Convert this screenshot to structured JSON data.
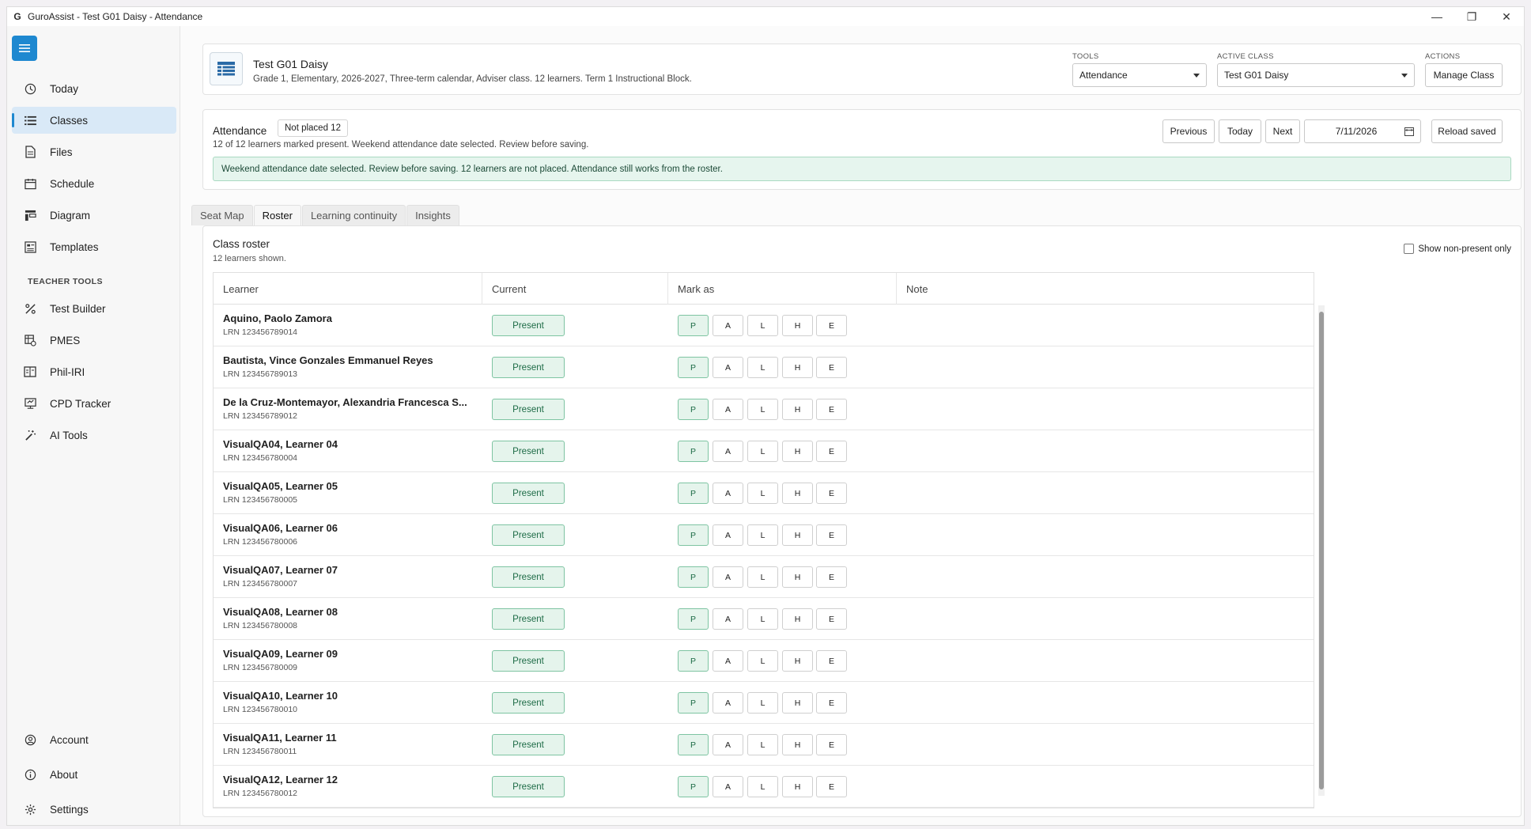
{
  "window": {
    "title": "GuroAssist - Test G01 Daisy - Attendance",
    "controls": {
      "minimize": "—",
      "maximize": "❐",
      "close": "✕"
    }
  },
  "sidebar": {
    "menu_icon": "hamburger-icon",
    "items": [
      {
        "label": "Today",
        "icon": "clock-icon"
      },
      {
        "label": "Classes",
        "icon": "list-icon",
        "active": true
      },
      {
        "label": "Files",
        "icon": "file-icon"
      },
      {
        "label": "Schedule",
        "icon": "calendar-icon"
      },
      {
        "label": "Diagram",
        "icon": "diagram-icon"
      },
      {
        "label": "Templates",
        "icon": "templates-icon"
      }
    ],
    "section_title": "TEACHER TOOLS",
    "tools": [
      {
        "label": "Test Builder",
        "icon": "percent-icon"
      },
      {
        "label": "PMES",
        "icon": "pmes-icon"
      },
      {
        "label": "Phil-IRI",
        "icon": "book-icon"
      },
      {
        "label": "CPD Tracker",
        "icon": "tracker-icon"
      },
      {
        "label": "AI Tools",
        "icon": "magic-wand-icon"
      }
    ],
    "bottom": [
      {
        "label": "Account",
        "icon": "account-icon"
      },
      {
        "label": "About",
        "icon": "info-icon"
      },
      {
        "label": "Settings",
        "icon": "gear-icon"
      }
    ]
  },
  "header": {
    "class_name": "Test G01 Daisy",
    "class_details": "Grade 1, Elementary, 2026-2027, Three-term calendar, Adviser class. 12 learners. Term 1 Instructional Block.",
    "tools_label": "TOOLS",
    "tools_value": "Attendance",
    "active_class_label": "ACTIVE CLASS",
    "active_class_value": "Test G01 Daisy",
    "actions_label": "ACTIONS",
    "manage_class": "Manage Class"
  },
  "attendance": {
    "title": "Attendance",
    "not_placed_badge": "Not placed 12",
    "summary": "12 of 12 learners marked present. Weekend attendance date selected. Review before saving.",
    "notice": "Weekend attendance date selected. Review before saving. 12 learners are not placed. Attendance still works from the roster.",
    "buttons": {
      "previous": "Previous",
      "today": "Today",
      "next": "Next",
      "reload": "Reload saved"
    },
    "date": "7/11/2026"
  },
  "tabs": [
    {
      "label": "Seat Map"
    },
    {
      "label": "Roster",
      "active": true
    },
    {
      "label": "Learning continuity"
    },
    {
      "label": "Insights"
    }
  ],
  "roster": {
    "title": "Class roster",
    "subtitle": "12 learners shown.",
    "filter_label": "Show non-present only",
    "columns": [
      "Learner",
      "Current",
      "Mark as",
      "Note"
    ],
    "mark_options": [
      "P",
      "A",
      "L",
      "H",
      "E"
    ],
    "rows": [
      {
        "name": "Aquino, Paolo Zamora",
        "lrn": "LRN 123456789014",
        "status": "Present"
      },
      {
        "name": "Bautista, Vince Gonzales Emmanuel Reyes",
        "lrn": "LRN 123456789013",
        "status": "Present"
      },
      {
        "name": "De la Cruz-Montemayor, Alexandria Francesca S...",
        "lrn": "LRN 123456789012",
        "status": "Present"
      },
      {
        "name": "VisualQA04, Learner 04",
        "lrn": "LRN 123456780004",
        "status": "Present"
      },
      {
        "name": "VisualQA05, Learner 05",
        "lrn": "LRN 123456780005",
        "status": "Present"
      },
      {
        "name": "VisualQA06, Learner 06",
        "lrn": "LRN 123456780006",
        "status": "Present"
      },
      {
        "name": "VisualQA07, Learner 07",
        "lrn": "LRN 123456780007",
        "status": "Present"
      },
      {
        "name": "VisualQA08, Learner 08",
        "lrn": "LRN 123456780008",
        "status": "Present"
      },
      {
        "name": "VisualQA09, Learner 09",
        "lrn": "LRN 123456780009",
        "status": "Present"
      },
      {
        "name": "VisualQA10, Learner 10",
        "lrn": "LRN 123456780010",
        "status": "Present"
      },
      {
        "name": "VisualQA11, Learner 11",
        "lrn": "LRN 123456780011",
        "status": "Present"
      },
      {
        "name": "VisualQA12, Learner 12",
        "lrn": "LRN 123456780012",
        "status": "Present"
      }
    ]
  },
  "colors": {
    "accent": "#1e88d0",
    "present_bg": "#e5f4ec",
    "present_border": "#7ec4a2",
    "notice_bg": "#e6f5ee"
  }
}
